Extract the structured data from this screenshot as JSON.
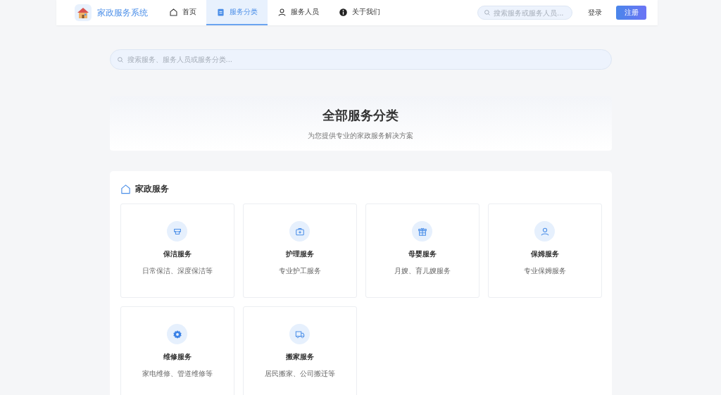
{
  "brand": {
    "name": "家政服务系统"
  },
  "nav": [
    {
      "label": "首页",
      "kind": "home",
      "selected": false
    },
    {
      "label": "服务分类",
      "kind": "clipboard",
      "selected": true
    },
    {
      "label": "服务人员",
      "kind": "user",
      "selected": false
    },
    {
      "label": "关于我们",
      "kind": "info",
      "selected": false
    }
  ],
  "header_search": {
    "placeholder": "搜索服务或服务人员..."
  },
  "login": "登录",
  "register": "注册",
  "main_search": {
    "placeholder": "搜索服务、服务人员或服务分类..."
  },
  "hero": {
    "title": "全部服务分类",
    "subtitle": "为您提供专业的家政服务解决方案"
  },
  "section": {
    "title": "家政服务",
    "cards": [
      {
        "kind": "cleaning",
        "name": "保洁服务",
        "desc": "日常保洁、深度保洁等"
      },
      {
        "kind": "medkit",
        "name": "护理服务",
        "desc": "专业护工服务"
      },
      {
        "kind": "gift",
        "name": "母婴服务",
        "desc": "月嫂、育儿嫂服务"
      },
      {
        "kind": "user",
        "name": "保姆服务",
        "desc": "专业保姆服务"
      },
      {
        "kind": "gear",
        "name": "维修服务",
        "desc": "家电维修、管道维修等"
      },
      {
        "kind": "truck",
        "name": "搬家服务",
        "desc": "居民搬家、公司搬迁等"
      }
    ]
  }
}
